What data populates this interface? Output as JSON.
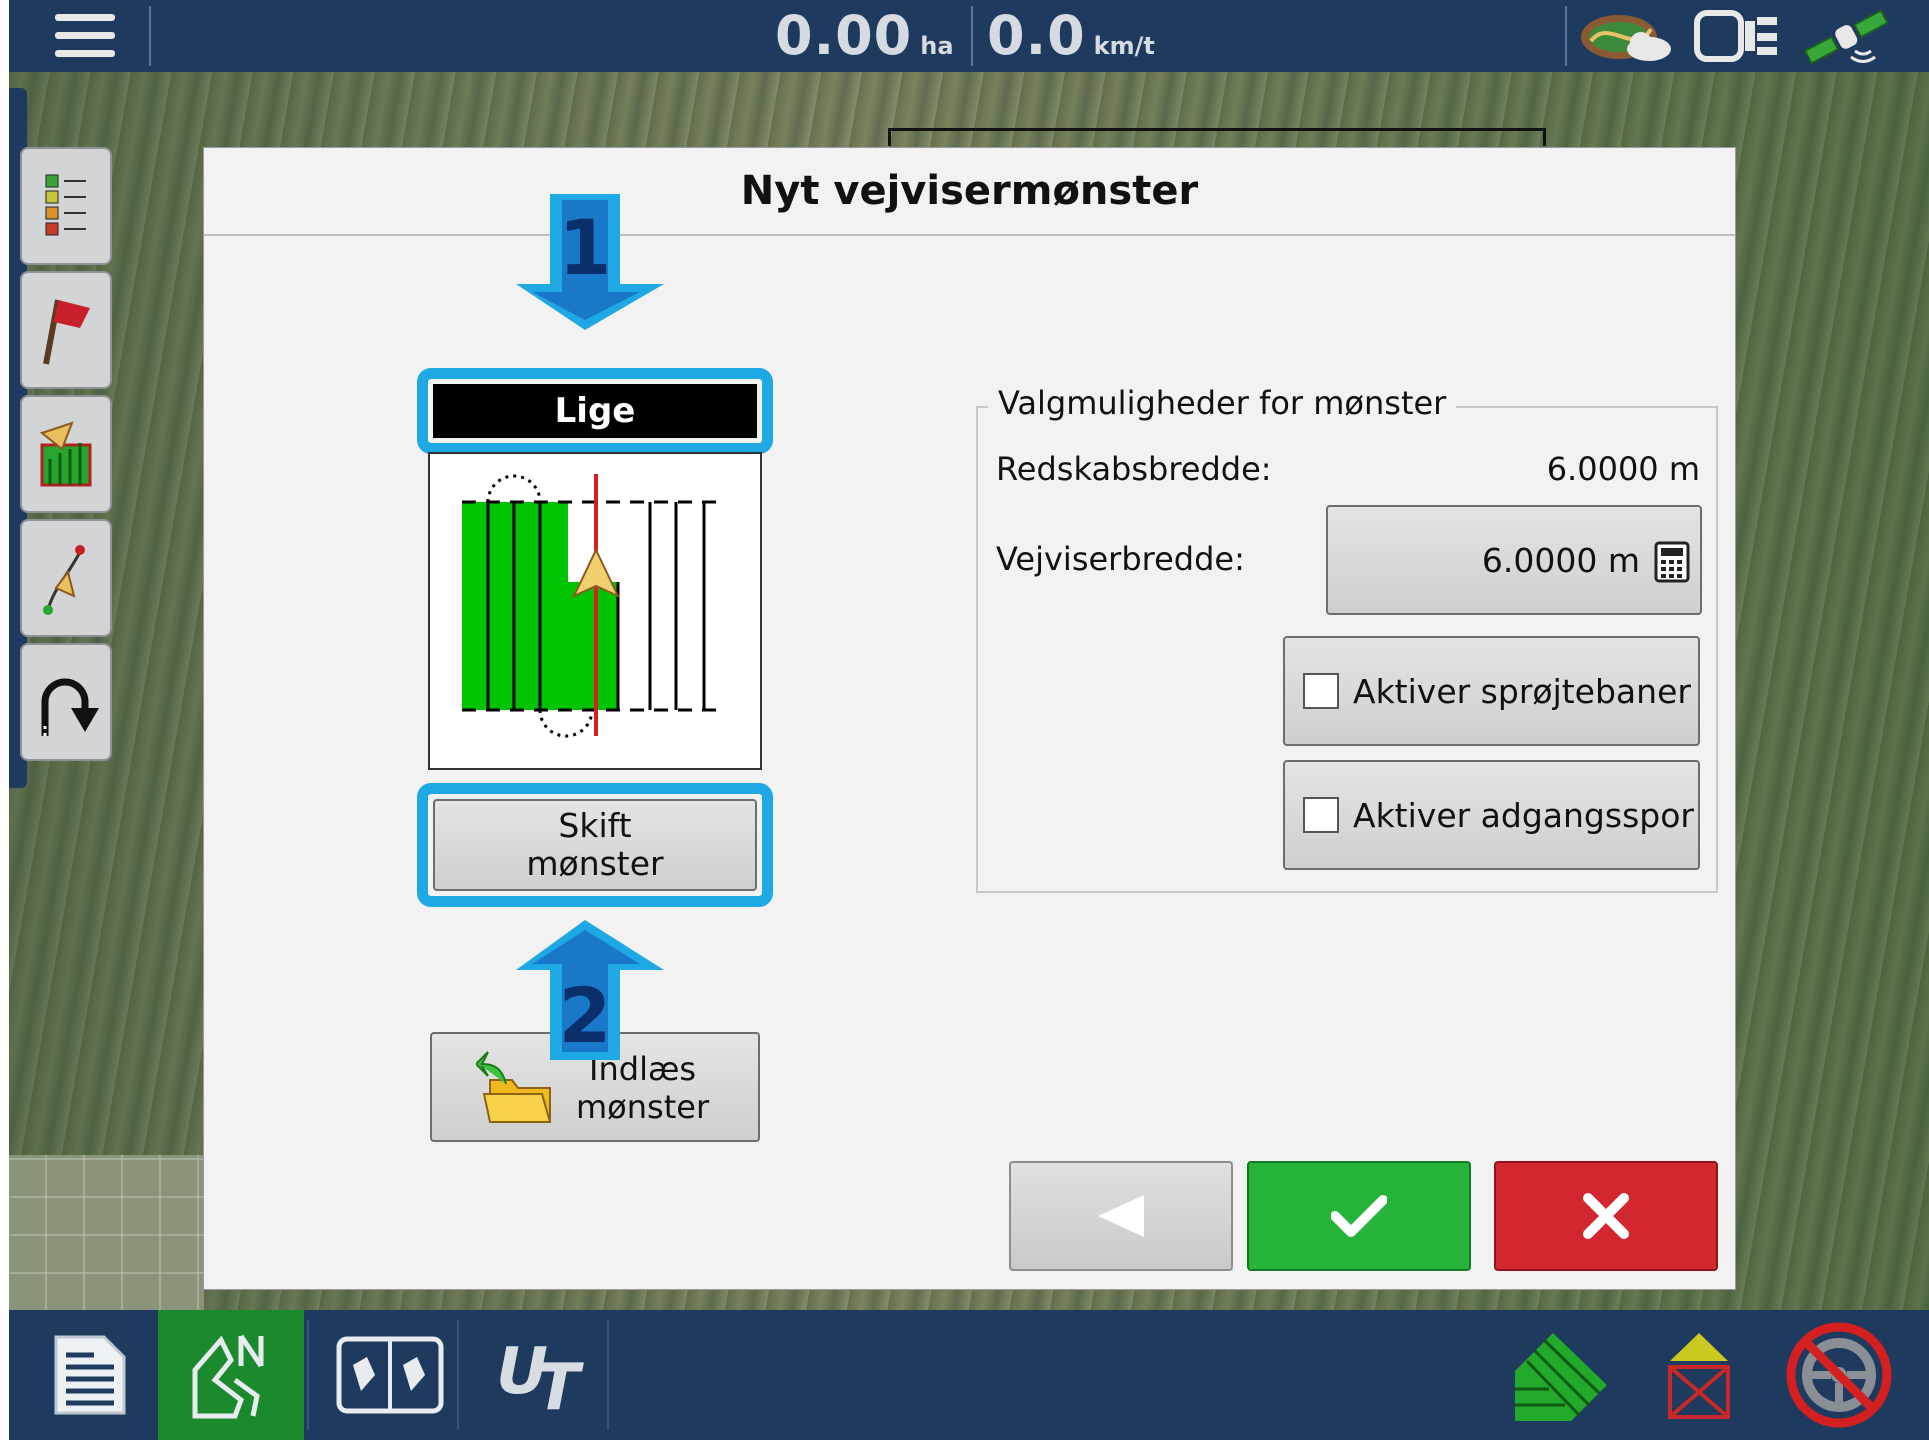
{
  "topbar": {
    "area_value": "0.00",
    "area_unit": "ha",
    "speed_value": "0.0",
    "speed_unit": "km/t",
    "icons": [
      "menu-icon",
      "field-weather-icon",
      "display-outputs-icon",
      "gps-satellite-icon"
    ]
  },
  "toolstrip": {
    "icons": [
      "legend-icon",
      "flag-icon",
      "map-layers-icon",
      "guidance-line-icon",
      "u-turn-icon"
    ]
  },
  "dialog": {
    "title": "Nyt vejvisermønster",
    "pattern": {
      "name": "Lige",
      "change_button_line1": "Skift",
      "change_button_line2": "mønster",
      "load_button_line1": "Indlæs",
      "load_button_line2": "mønster"
    },
    "callouts": {
      "first": "1",
      "second": "2",
      "color": "#1fa9e4"
    },
    "options": {
      "legend": "Valgmuligheder for mønster",
      "implement_width_label": "Redskabsbredde:",
      "implement_width_value": "6.0000 m",
      "guide_width_label": "Vejviserbredde:",
      "guide_width_value": "6.0000 m",
      "tramlines_label": "Aktiver sprøjtebaner",
      "tramlines_checked": false,
      "access_track_label": "Aktiver adgangsspor",
      "access_track_checked": false
    },
    "actions": {
      "back_color": "#d4d4d4",
      "ok_color": "#25b33a",
      "cancel_color": "#d32730"
    }
  },
  "bottombar": {
    "icons": [
      "summary-icon",
      "map-icon",
      "split-screen-icon",
      "ut-icon",
      "coverage-icon",
      "section-off-icon",
      "steering-disabled-icon"
    ],
    "active_index": 1,
    "active_color": "#1a8a2c"
  }
}
